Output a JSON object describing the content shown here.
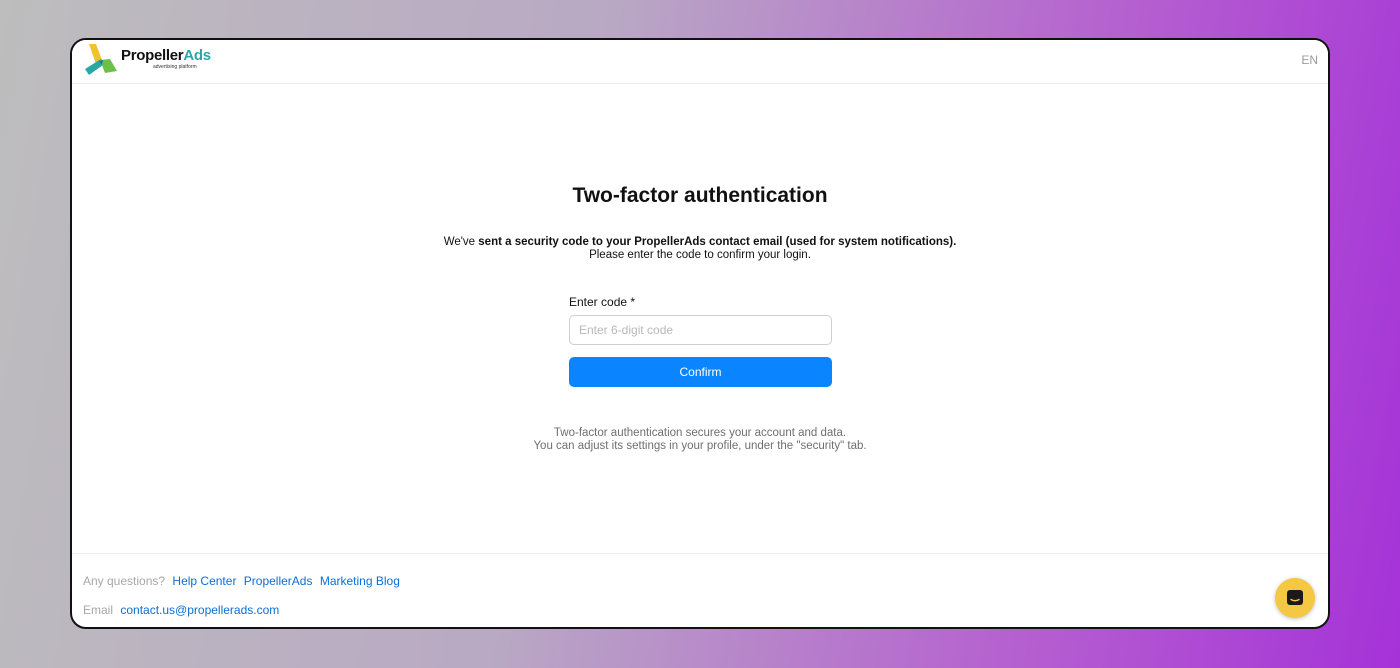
{
  "header": {
    "logo": {
      "name_part1": "Propeller",
      "name_part2": "Ads",
      "tagline": "advertising platform",
      "colors": {
        "teal": "#2aa8a3",
        "yellow": "#f2c12e",
        "green": "#6cc04a",
        "dark": "#111111"
      }
    },
    "language": "EN"
  },
  "main": {
    "title": "Two-factor authentication",
    "description": {
      "prefix": "We've ",
      "bold": "sent a security code to your PropellerAds contact email (used for system notifications).",
      "line2": "Please enter the code to confirm your login."
    },
    "code_field": {
      "label": "Enter code *",
      "placeholder": "Enter 6-digit code",
      "value": ""
    },
    "confirm_label": "Confirm",
    "note": {
      "line1": "Two-factor authentication secures your account and data.",
      "line2": "You can adjust its settings in your profile, under the \"security\" tab."
    }
  },
  "footer": {
    "questions_label": "Any questions?",
    "links": [
      "Help Center",
      "PropellerAds",
      "Marketing Blog"
    ],
    "email_label": "Email",
    "email": "contact.us@propellerads.com"
  },
  "chat": {
    "icon": "chat-bubble-icon",
    "color": "#f4c842"
  },
  "colors": {
    "primary": "#0a84ff",
    "link": "#0a6fd6"
  }
}
